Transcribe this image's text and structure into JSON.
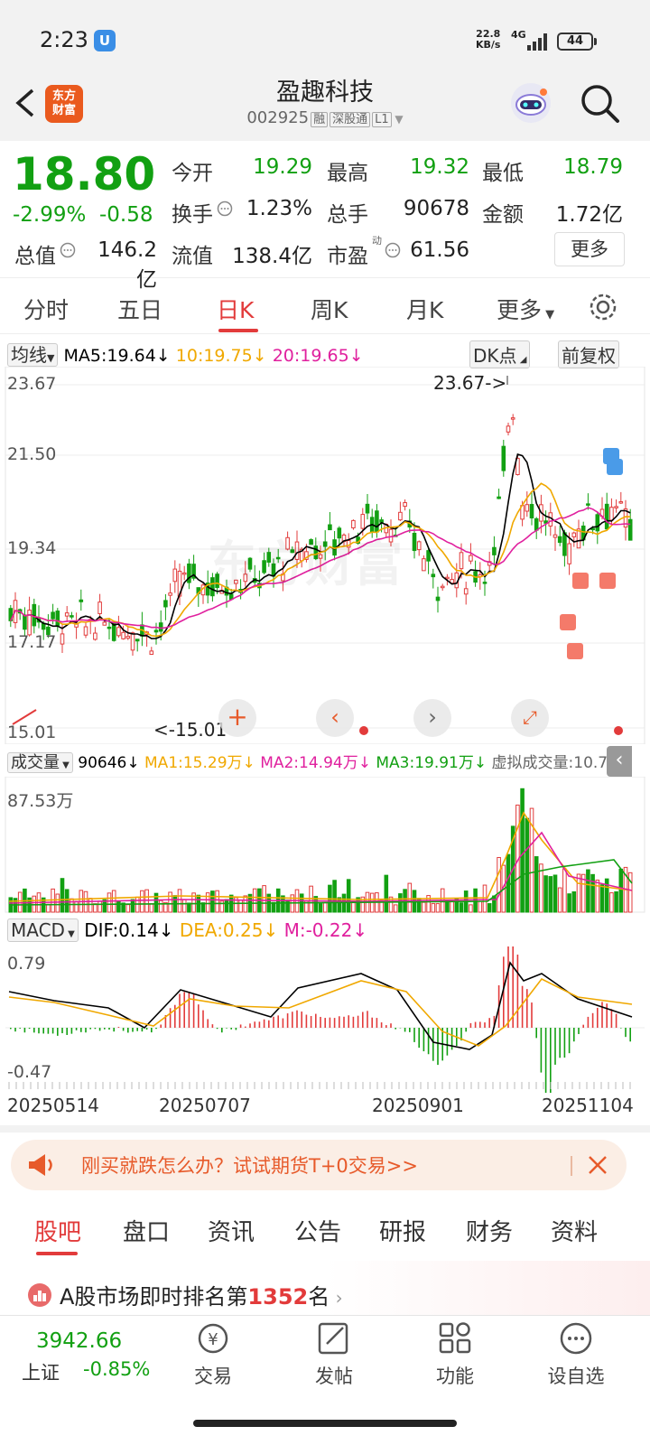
{
  "status": {
    "time": "2:23",
    "net_speed_top": "22.8",
    "net_speed_bottom": "KB/s",
    "net_type": "4G",
    "battery": "44"
  },
  "header": {
    "logo_line1": "东方",
    "logo_line2": "财富",
    "name": "盈趣科技",
    "code": "002925",
    "tag1": "融",
    "tag2": "深股通",
    "tag3": "L1"
  },
  "quote": {
    "price": "18.80",
    "change_pct": "-2.99%",
    "change": "-0.58",
    "open_label": "今开",
    "open": "19.29",
    "high_label": "最高",
    "high": "19.32",
    "low_label": "最低",
    "low": "18.79",
    "turnover_label": "换手",
    "turnover": "1.23%",
    "volume_label": "总手",
    "volume": "90678",
    "amount_label": "金额",
    "amount": "1.72亿",
    "mktcap_label": "总值",
    "mktcap": "146.2亿",
    "float_label": "流值",
    "float": "138.4亿",
    "pe_label": "市盈",
    "pe_sup": "动",
    "pe": "61.56",
    "more_label": "更多"
  },
  "period_tabs": [
    "分时",
    "五日",
    "日K",
    "周K",
    "月K",
    "更多"
  ],
  "kline": {
    "ma_select": "均线",
    "ma5": "MA5:19.64↓",
    "ma10": "10:19.75↓",
    "ma20": "20:19.65↓",
    "dk_label": "DK点",
    "adjust_label": "前复权",
    "y_labels": [
      "23.67",
      "21.50",
      "19.34",
      "17.17",
      "15.01"
    ],
    "max_annot": "23.67->",
    "min_annot": "<-15.01",
    "watermark": "东方财富"
  },
  "volume": {
    "select": "成交量",
    "value": "90646↓",
    "ma1": "MA1:15.29万↓",
    "ma2": "MA2:14.94万↓",
    "ma3": "MA3:19.91万↓",
    "virtual": "虚拟成交量:10.76万",
    "y_label": "87.53万"
  },
  "macd": {
    "select": "MACD",
    "dif": "DIF:0.14↓",
    "dea": "DEA:0.25↓",
    "m": "M:-0.22↓",
    "y_top": "0.79",
    "y_bottom": "-0.47",
    "dates": [
      "20250514",
      "20250707",
      "20250901",
      "20251104"
    ]
  },
  "colors": {
    "up": "#e23b3b",
    "down": "#12a012",
    "ma5": "#000000",
    "ma10": "#f0a800",
    "ma20": "#e0209e",
    "accent": "#e23b3b"
  },
  "banner": {
    "text": "刚买就跌怎么办？试试期货T+0交易>>"
  },
  "bottom_tabs": [
    "股吧",
    "盘口",
    "资讯",
    "公告",
    "研报",
    "财务",
    "资料"
  ],
  "rank": {
    "prefix": "A股市场即时排名第",
    "number": "1352",
    "suffix": "名"
  },
  "nav": {
    "index_value": "3942.66",
    "index_name": "上证",
    "index_change": "-0.85%",
    "items": [
      "交易",
      "发帖",
      "功能",
      "设自选"
    ]
  }
}
